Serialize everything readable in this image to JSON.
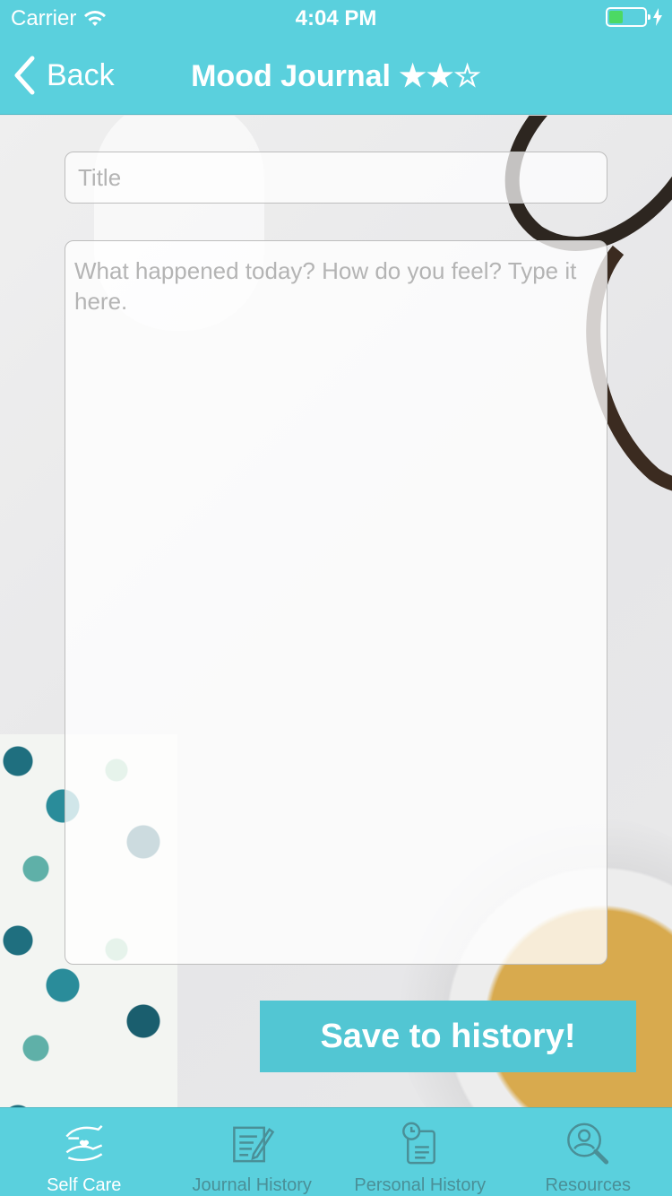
{
  "status_bar": {
    "carrier": "Carrier",
    "time": "4:04 PM",
    "battery_level": 0.4,
    "battery_color": "#4cd964"
  },
  "nav": {
    "back_label": "Back",
    "title": "Mood Journal ★★☆"
  },
  "form": {
    "title_placeholder": "Title",
    "title_value": "",
    "body_placeholder": "What happened today? How do you feel? Type it here.",
    "body_value": ""
  },
  "save_button_label": "Save to history!",
  "tabs": [
    {
      "label": "Self Care",
      "icon": "hands-heart-icon",
      "active": true
    },
    {
      "label": "Journal History",
      "icon": "journal-edit-icon",
      "active": false
    },
    {
      "label": "Personal History",
      "icon": "clipboard-clock-icon",
      "active": false
    },
    {
      "label": "Resources",
      "icon": "user-search-icon",
      "active": false
    }
  ],
  "colors": {
    "accent": "#5ad0dd",
    "button": "#52c6d3",
    "inactive_tab": "#4a8f97"
  }
}
